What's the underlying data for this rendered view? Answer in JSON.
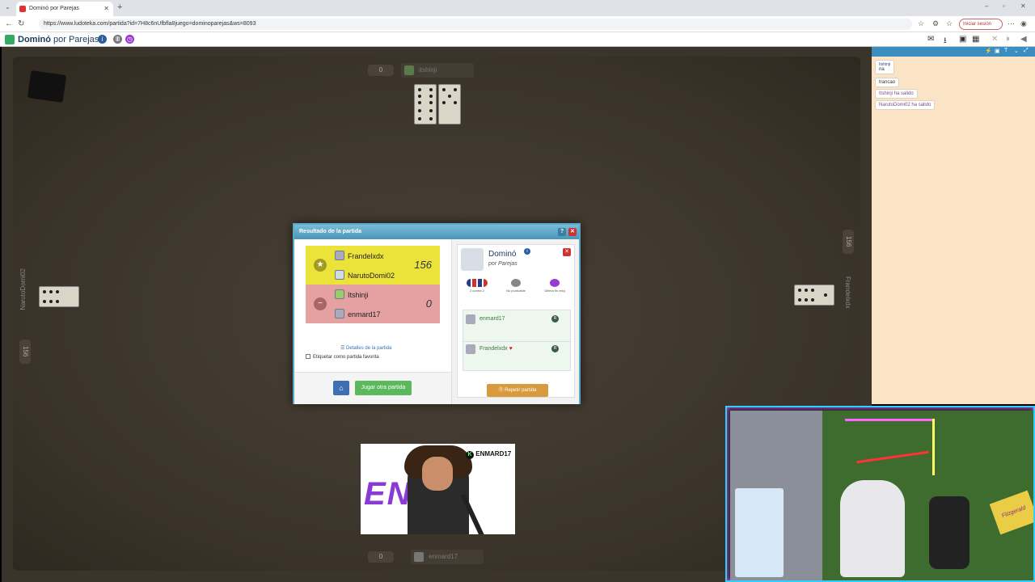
{
  "browser": {
    "tab_title": "Dominó por Parejas",
    "url": "https://www.ludoteka.com/partida?id=7H8c6nUfbfla8juego=dominoparejas&ws=8093",
    "signin_label": "Iniciar sesión"
  },
  "site": {
    "title_main": "Dominó",
    "title_sub": "por Parejas"
  },
  "board": {
    "top_player": "itshinji",
    "top_score": "0",
    "bottom_player": "enmard17",
    "bottom_score": "0",
    "left_player": "NarutoDomi02",
    "left_score": "156",
    "right_player": "Frandelxdx",
    "right_score": "156"
  },
  "result_modal": {
    "title": "Resultado de la partida",
    "help_label": "?",
    "close_label": "✕",
    "winners": {
      "players": [
        "Frandelxdx",
        "NarutoDomi02"
      ],
      "points": "156"
    },
    "losers": {
      "players": [
        "Itshinji",
        "enmard17"
      ],
      "points": "0"
    },
    "details_link": "Detalles de la partida",
    "favorite_label": "Etiquetar como partida favorita",
    "play_again_label": "Jugar otra partida",
    "game_card": {
      "name": "Dominó",
      "subtitle": "por Parejas",
      "options": [
        "2 contra 2",
        "No puntuable",
        "Última fin reloj"
      ],
      "players": [
        "enmard17",
        "Frandelxdx"
      ],
      "repeat_label": "Repetir partida"
    }
  },
  "chat": {
    "messages": [
      {
        "author": "Itshinji",
        "text": "na"
      },
      {
        "author": "",
        "text": "trancao"
      },
      {
        "author": "",
        "text": "Itshinji ha salido",
        "system": true
      },
      {
        "author": "",
        "text": "NarutoDomi02 ha salido",
        "system": true
      }
    ]
  },
  "overlay": {
    "streamer_text": "ENM",
    "streamer_tag": "ENMARD17",
    "sign_text": "Fitzgerald"
  },
  "colors": {
    "winner_bg": "#ebe23a",
    "loser_bg": "#e5a0a2",
    "modal_header": "#4a95b8",
    "chat_bg": "#fbe3c6",
    "board_bg": "#3b342b"
  }
}
